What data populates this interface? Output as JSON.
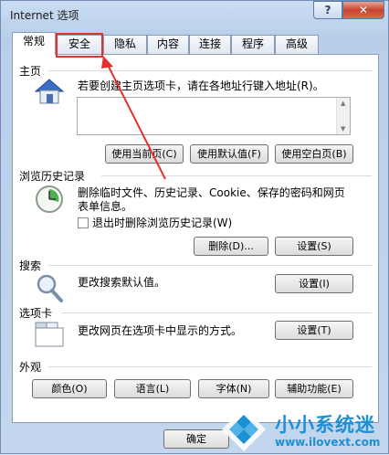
{
  "window": {
    "title": "Internet 选项",
    "help": "?",
    "close": "✕"
  },
  "tabs": [
    "常规",
    "安全",
    "隐私",
    "内容",
    "连接",
    "程序",
    "高级"
  ],
  "homepage": {
    "title": "主页",
    "description": "若要创建主页选项卡，请在各地址行键入地址(R)。",
    "value": "",
    "buttons": [
      "使用当前页(C)",
      "使用默认值(F)",
      "使用空白页(B)"
    ]
  },
  "history": {
    "title": "浏览历史记录",
    "description": "删除临时文件、历史记录、Cookie、保存的密码和网页表单信息。",
    "checkbox_label": "退出时删除浏览历史记录(W)",
    "buttons": [
      "删除(D)...",
      "设置(S)"
    ]
  },
  "search": {
    "title": "搜索",
    "description": "更改搜索默认值。",
    "button": "设置(I)"
  },
  "tabs_section": {
    "title": "选项卡",
    "description": "更改网页在选项卡中显示的方式。",
    "button": "设置(T)"
  },
  "appearance": {
    "title": "外观",
    "buttons": [
      "颜色(O)",
      "语言(L)",
      "字体(N)",
      "辅助功能(E)"
    ]
  },
  "footer": {
    "ok": "确定"
  },
  "watermark": {
    "name": "小小系统迷",
    "url": "www.ilovext.com"
  },
  "colors": {
    "highlight": "#e5312e",
    "watermark": "#1d8fd3"
  }
}
